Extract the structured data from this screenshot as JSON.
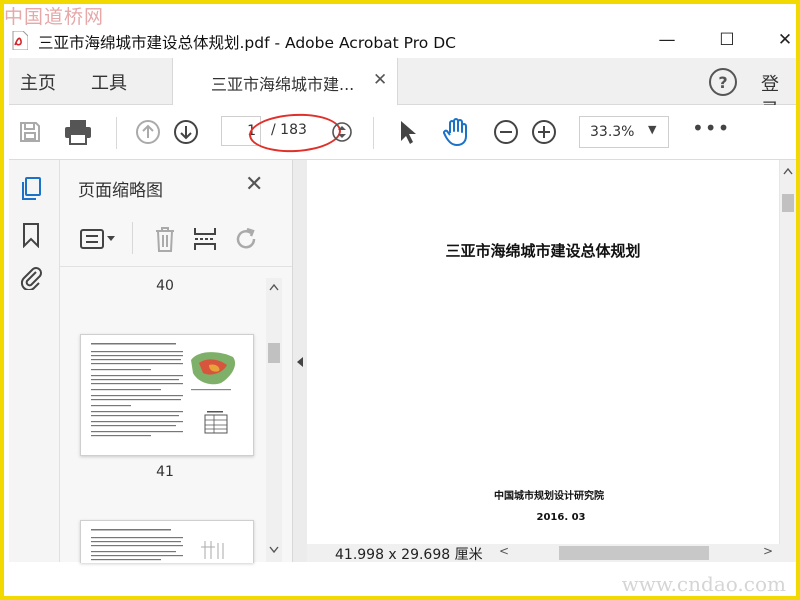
{
  "watermark": {
    "top_left": "中国道桥网",
    "bottom_right": "www.cndao.com"
  },
  "window": {
    "title": "三亚市海绵城市建设总体规划.pdf - Adobe Acrobat Pro DC",
    "minimize": "—",
    "maximize": "☐",
    "close": "✕"
  },
  "menu": {
    "home": "主页",
    "tools": "工具",
    "tab_label": "三亚市海绵城市建...",
    "tab_close": "✕",
    "help": "?",
    "login": "登录"
  },
  "toolbar": {
    "current_page": "1",
    "total_pages": "/ 183",
    "zoom": "33.3%",
    "zoom_caret": "▼",
    "more": "•••"
  },
  "panel": {
    "title": "页面缩略图",
    "close": "✕",
    "thumbnails": [
      {
        "label": "40"
      },
      {
        "label": "41"
      }
    ]
  },
  "document": {
    "title": "三亚市海绵城市建设总体规划",
    "organization": "中国城市规划设计研究院",
    "date": "2016. 03"
  },
  "status": {
    "dimensions": "41.998 x 29.698 厘米",
    "scroll_left": "<",
    "scroll_right": ">"
  },
  "colors": {
    "accent": "#1a73c9",
    "frame": "#f2d900",
    "highlight_oval": "#e0302a"
  }
}
